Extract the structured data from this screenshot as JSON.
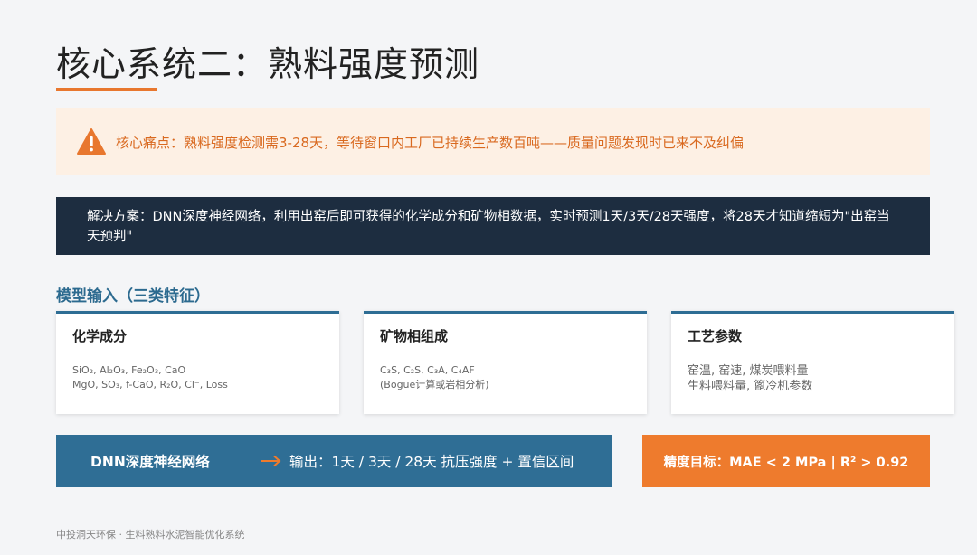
{
  "title": "核心系统二：熟料强度预测",
  "pain_point": {
    "text": "核心痛点：熟料强度检测需3-28天，等待窗口内工厂已持续生产数百吨——质量问题发现时已来不及纠偏",
    "icon": "warning-icon",
    "color": "#d9691f"
  },
  "solution": {
    "text": "解决方案：DNN深度神经网络，利用出窑后即可获得的化学成分和矿物相数据，实时预测1天/3天/28天强度，将28天才知道缩短为\"出窑当天预判\""
  },
  "inputs": {
    "heading": "模型输入（三类特征）",
    "cards": [
      {
        "title": "化学成分",
        "lines": [
          "SiO₂, Al₂O₃, Fe₂O₃, CaO",
          "MgO, SO₃, f-CaO, R₂O, Cl⁻, Loss"
        ]
      },
      {
        "title": "矿物相组成",
        "lines": [
          "C₃S, C₂S, C₃A, C₄AF",
          "(Bogue计算或岩相分析)"
        ]
      },
      {
        "title": "工艺参数",
        "lines": [
          "窑温, 窑速, 煤炭喂料量",
          "生料喂料量, 篦冷机参数"
        ]
      }
    ]
  },
  "model": {
    "label": "DNN深度神经网络",
    "output": "输出：1天 / 3天 / 28天 抗压强度 + 置信区间",
    "icon": "arrow-right-icon"
  },
  "target": {
    "text": "精度目标：MAE < 2 MPa | R² > 0.92"
  },
  "footer": "中投洞天环保 · 生料熟料水泥智能优化系统",
  "colors": {
    "accent_orange": "#ee7b2d",
    "navy": "#1d2d40",
    "steel_blue": "#2f6e95"
  }
}
